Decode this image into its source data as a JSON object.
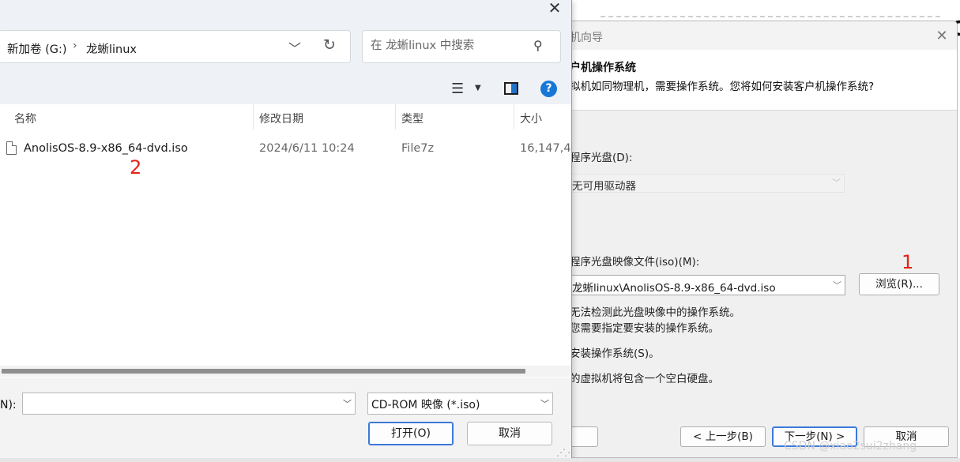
{
  "wizard": {
    "title_fragment": "机向导",
    "header_title": "户机操作系统",
    "header_sub": "拟机如同物理机，需要操作系统。您将如何安装客户机操作系统?",
    "drive_label": "程序光盘(D):",
    "drive_value": "无可用驱动器",
    "iso_label": "程序光盘映像文件(iso)(M):",
    "iso_value": "龙蜥linux\\AnolisOS-8.9-x86_64-dvd.iso",
    "browse_label": "浏览(R)...",
    "notice_line1": "无法检测此光盘映像中的操作系统。",
    "notice_line2": "您需要指定要安装的操作系统。",
    "later_option": "安装操作系统(S)。",
    "later_desc": "的虚拟机将包含一个空白硬盘。",
    "back_label": "< 上一步(B)",
    "next_label": "下一步(N) >",
    "cancel_label": "取消",
    "annotation_1": "1",
    "watermark": "CSDN @xiao2sui2zhang",
    "edge_char": "C"
  },
  "dialog": {
    "breadcrumb": [
      "新加卷 (G:)",
      "龙蜥linux"
    ],
    "breadcrumb_sep": "›",
    "search_placeholder": "在 龙蜥linux 中搜索",
    "columns": [
      "名称",
      "修改日期",
      "类型",
      "大小"
    ],
    "files": [
      {
        "name": "AnolisOS-8.9-x86_64-dvd.iso",
        "modified": "2024/6/11 10:24",
        "type": "File7z",
        "size": "16,147,4"
      }
    ],
    "annotation_2": "2",
    "filename_label": "N):",
    "filename_value": "",
    "filetype_value": "CD-ROM 映像 (*.iso)",
    "open_label": "打开(O)",
    "cancel_label": "取消"
  },
  "icons": {
    "close": "close-icon",
    "search": "search-icon",
    "refresh": "refresh-icon",
    "help": "help-icon",
    "accent_color": "#1877d6",
    "annotation_color": "#e2231a"
  }
}
